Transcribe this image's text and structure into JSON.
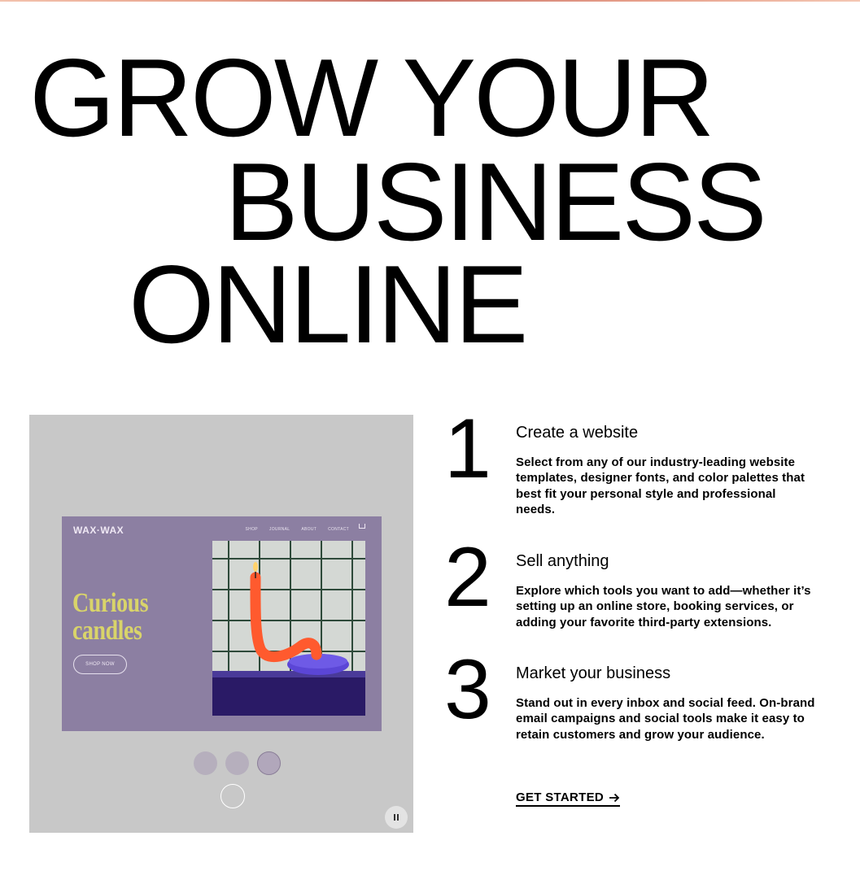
{
  "hero": {
    "line1": "GROW YOUR",
    "line2": "BUSINESS",
    "line3": "ONLINE"
  },
  "showcase": {
    "mock_site": {
      "logo": "WAX·WAX",
      "nav": [
        "SHOP",
        "JOURNAL",
        "ABOUT",
        "CONTACT"
      ],
      "cart_icon": "cart-icon",
      "headline_line1": "Curious",
      "headline_line2": "candles",
      "button_label": "SHOP NOW",
      "accent_color": "#d9d46a",
      "background_color": "#8c7fa2"
    },
    "pager_dots": 3,
    "active_dot": 3,
    "pause_icon": "pause-icon"
  },
  "steps": [
    {
      "number": "1",
      "title": "Create a website",
      "description": "Select from any of our industry-leading website templates, designer fonts, and color palettes that best fit your personal style and professional needs."
    },
    {
      "number": "2",
      "title": "Sell anything",
      "description": "Explore which tools you want to add—whether it’s setting up an online store, booking services, or adding your favorite third-party extensions."
    },
    {
      "number": "3",
      "title": "Market your business",
      "description": "Stand out in every inbox and social feed. On-brand email campaigns and social tools make it easy to retain customers and grow your audience."
    }
  ],
  "cta": {
    "label": "GET STARTED",
    "icon": "arrow-right-icon"
  }
}
